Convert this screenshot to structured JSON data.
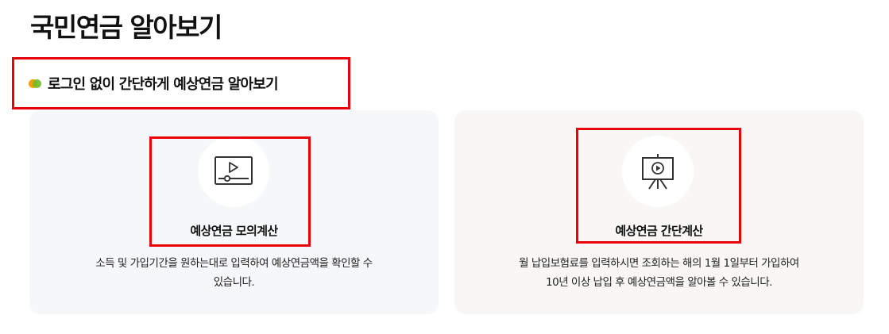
{
  "page": {
    "title": "국민연금 알아보기"
  },
  "section": {
    "heading": "로그인 없이 간단하게 예상연금 알아보기",
    "bullet_icon": "two-color-dot-icon",
    "colors": {
      "dot_orange": "#f5a000",
      "dot_green": "#6fba2c",
      "highlight": "#e8000b"
    }
  },
  "cards": [
    {
      "icon": "video-player-icon",
      "title": "예상연금 모의계산",
      "description_lines": [
        "소득 및 가입기간을 원하는대로 입력하여 예상연금액을 확인할 수",
        "있습니다."
      ]
    },
    {
      "icon": "presentation-board-icon",
      "title": "예상연금 간단계산",
      "description_lines": [
        "월 납입보험료를 입력하시면 조회하는 해의 1월 1일부터 가입하여",
        "10년 이상 납입 후 예상연금액을 알아볼 수 있습니다."
      ]
    }
  ]
}
